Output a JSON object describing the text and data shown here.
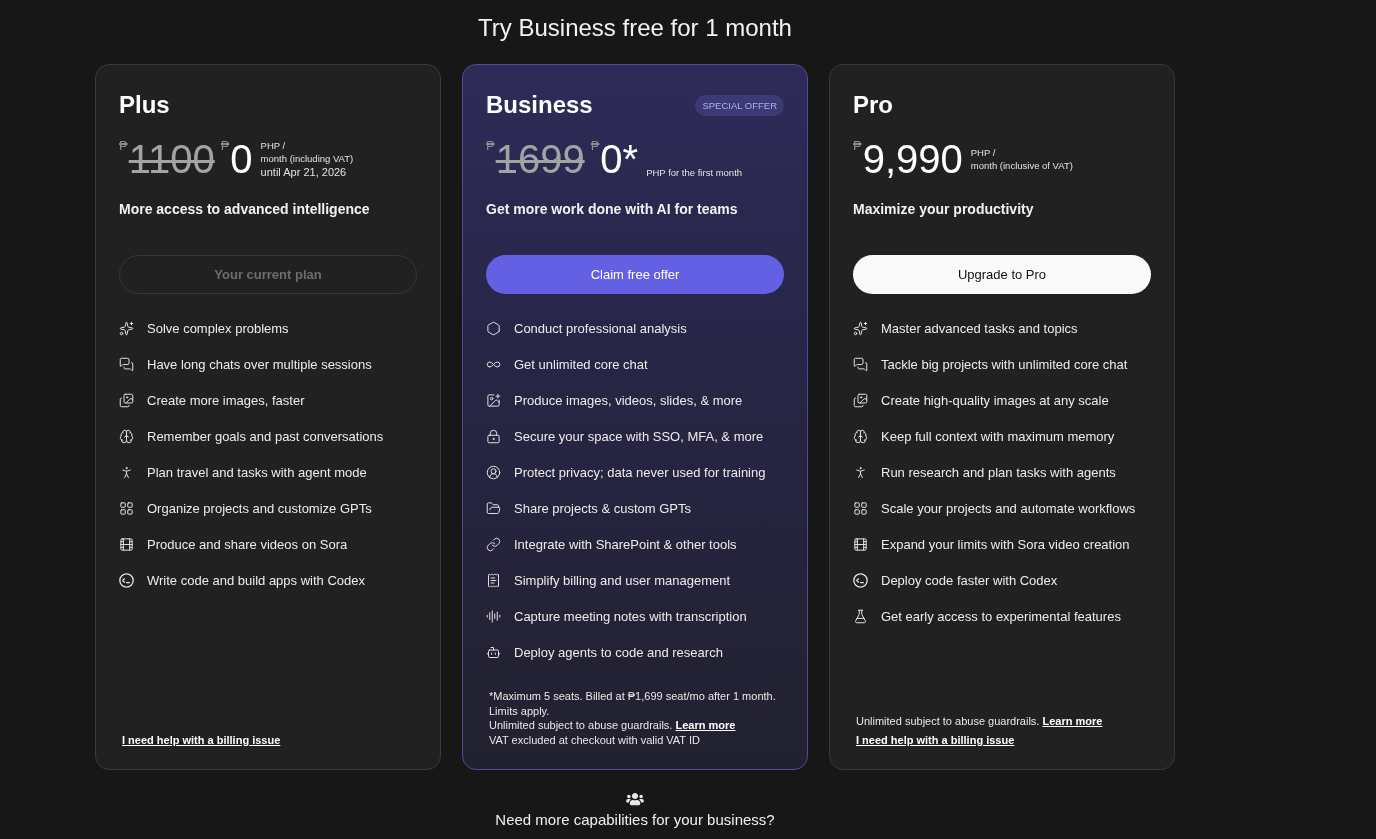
{
  "page": {
    "title": "Try Business free for 1 month"
  },
  "plans": [
    {
      "name": "Plus",
      "featured": false,
      "old_price": {
        "currency": "₱",
        "amount": "1100"
      },
      "price": {
        "currency": "₱",
        "amount": "0"
      },
      "price_unit": [
        "PHP /",
        "month (including VAT)"
      ],
      "price_term": "until Apr 21, 2026",
      "tagline": "More access to advanced intelligence",
      "button": {
        "label": "Your current plan",
        "kind": "current"
      },
      "features": [
        "Solve complex problems",
        "Have long chats over multiple sessions",
        "Create more images, faster",
        "Remember goals and past conversations",
        "Plan travel and tasks with agent mode",
        "Organize projects and customize GPTs",
        "Produce and share videos on Sora",
        "Write code and build apps with Codex"
      ],
      "footer": [
        {
          "link": "I need help with a billing issue"
        }
      ]
    },
    {
      "name": "Business",
      "featured": true,
      "badge": "SPECIAL OFFER",
      "old_price": {
        "currency": "₱",
        "amount": "1699"
      },
      "price": {
        "currency": "₱",
        "amount": "0*"
      },
      "price_unit": [
        "PHP for the first month"
      ],
      "tagline": "Get more work done with AI for teams",
      "button": {
        "label": "Claim free offer",
        "kind": "accent"
      },
      "features": [
        "Conduct professional analysis",
        "Get unlimited core chat",
        "Produce images, videos, slides, & more",
        "Secure your space with SSO, MFA, & more",
        "Protect privacy; data never used for training",
        "Share projects & custom GPTs",
        "Integrate with SharePoint & other tools",
        "Simplify billing and user management",
        "Capture meeting notes with transcription",
        "Deploy agents to code and research"
      ],
      "footer": [
        {
          "text": "*Maximum 5 seats. Billed at ₱1,699 seat/mo after 1 month. Limits apply."
        },
        {
          "text": "Unlimited subject to abuse guardrails.",
          "link": "Learn more"
        },
        {
          "text": "VAT excluded at checkout with valid VAT ID"
        }
      ]
    },
    {
      "name": "Pro",
      "featured": false,
      "price": {
        "currency": "₱",
        "amount": "9,990"
      },
      "price_unit": [
        "PHP /",
        "month (inclusive of VAT)"
      ],
      "tagline": "Maximize your productivity",
      "button": {
        "label": "Upgrade to Pro",
        "kind": "light"
      },
      "features": [
        "Master advanced tasks and topics",
        "Tackle big projects with unlimited core chat",
        "Create high-quality images at any scale",
        "Keep full context with maximum memory",
        "Run research and plan tasks with agents",
        "Scale your projects and automate workflows",
        "Expand your limits with Sora video creation",
        "Deploy code faster with Codex",
        "Get early access to experimental features"
      ],
      "footer": [
        {
          "text": "Unlimited subject to abuse guardrails.",
          "link": "Learn more"
        },
        {
          "link": "I need help with a billing issue"
        }
      ]
    }
  ],
  "bottom_prompt": {
    "text": "Need more capabilities for your business?"
  }
}
